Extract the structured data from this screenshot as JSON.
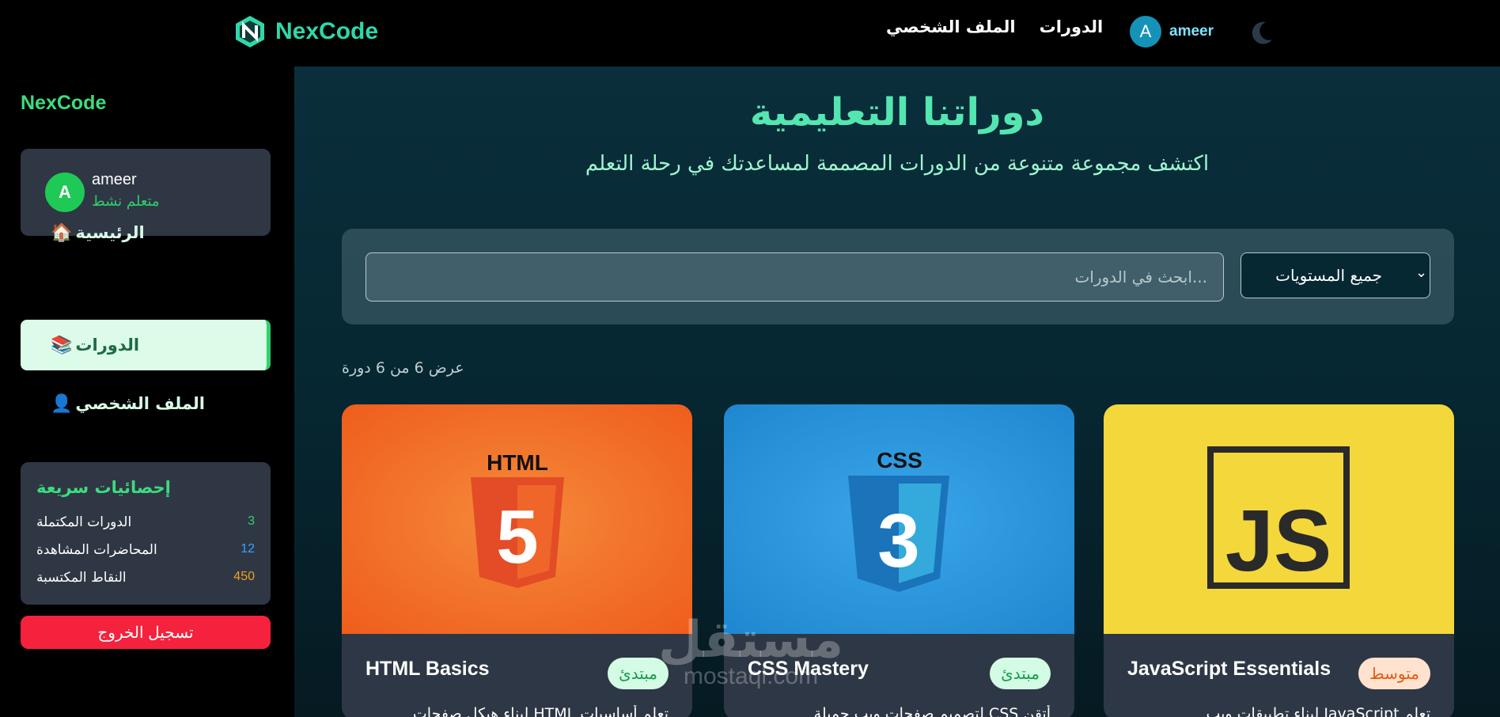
{
  "topbar": {
    "brand_name": "NexCode",
    "nav_courses": "الدورات",
    "nav_profile": "الملف الشخصي",
    "avatar_letter": "A",
    "user_name": "ameer",
    "theme_icon": "moon-icon"
  },
  "sidebar": {
    "brand_name": "NexCode",
    "user": {
      "avatar_letter": "A",
      "name": "ameer",
      "status": "متعلم نشط"
    },
    "items": [
      {
        "label": "الرئيسية",
        "emoji": "🏠",
        "active": false
      },
      {
        "label": "الدورات",
        "emoji": "📚",
        "active": true
      },
      {
        "label": "الملف الشخصي",
        "emoji": "👤",
        "active": false
      }
    ],
    "stats": {
      "title": "إحصائيات سريعة",
      "rows": [
        {
          "label": "الدورات المكتملة",
          "value": "3",
          "color": "#2fd06e"
        },
        {
          "label": "المحاضرات المشاهدة",
          "value": "12",
          "color": "#3aa3ff"
        },
        {
          "label": "النقاط المكتسبة",
          "value": "450",
          "color": "#f0a020"
        }
      ]
    },
    "logout_label": "تسجيل الخروج"
  },
  "main": {
    "title": "دوراتنا التعليمية",
    "subtitle": "اكتشف مجموعة متنوعة من الدورات المصممة لمساعدتك في رحلة التعلم",
    "search_placeholder": "...ابحث في الدورات",
    "level_filter": "جميع المستويات",
    "results_count": "عرض 6 من 6 دورة",
    "courses": [
      {
        "title": "HTML Basics",
        "level": "مبتدئ",
        "desc": "تعلم أساسيات HTML لبناء هيكل صفحات",
        "logo_text": "HTML",
        "logo_num": "5",
        "bg": "#f0621e"
      },
      {
        "title": "CSS Mastery",
        "level": "مبتدئ",
        "desc": "أتقن CSS لتصميم صفحات ويب جميلة",
        "logo_text": "CSS",
        "logo_num": "3",
        "bg": "#2390d9"
      },
      {
        "title": "JavaScript Essentials",
        "level": "متوسط",
        "desc": "تعلم JavaScript لبناء تطبيقات ويب",
        "logo_text": "JS",
        "bg": "#f4d73b"
      }
    ]
  },
  "watermark": {
    "arabic": "مستقل",
    "latin": "mostaql.com"
  }
}
